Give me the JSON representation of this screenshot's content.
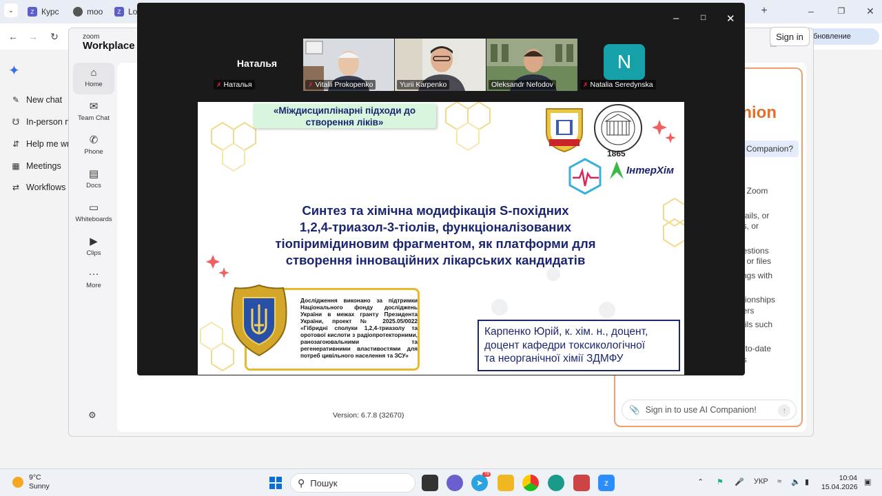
{
  "browser": {
    "tabs": [
      {
        "icon": "zoom-favicon",
        "label": "Курс"
      },
      {
        "icon": "moodle-favicon",
        "label": "moo"
      },
      {
        "icon": "zoom-favicon",
        "label": "Lo"
      }
    ],
    "update_label": "ть обновление"
  },
  "copilot_sidebar": {
    "items": [
      {
        "icon": "new-chat-icon",
        "label": "New chat"
      },
      {
        "icon": "in-person-icon",
        "label": "In-person no"
      },
      {
        "icon": "help-write-icon",
        "label": "Help me wri"
      },
      {
        "icon": "meetings-icon",
        "label": "Meetings"
      },
      {
        "icon": "workflows-icon",
        "label": "Workflows"
      }
    ]
  },
  "zoom_app": {
    "brand_small": "zoom",
    "brand_big": "Workplace",
    "rail": [
      {
        "icon": "home-icon",
        "label": "Home",
        "active": true
      },
      {
        "icon": "team-chat-icon",
        "label": "Team Chat"
      },
      {
        "icon": "phone-icon",
        "label": "Phone"
      },
      {
        "icon": "docs-icon",
        "label": "Docs"
      },
      {
        "icon": "whiteboards-icon",
        "label": "Whiteboards"
      },
      {
        "icon": "clips-icon",
        "label": "Clips"
      },
      {
        "icon": "more-icon",
        "label": "More"
      }
    ],
    "version": "Version: 6.7.8 (32670)",
    "sign_in": "Sign in"
  },
  "ai_companion": {
    "title": "anion",
    "chip": "Companion?",
    "lines": [
      "al Zoom",
      "mails, or",
      "es, or",
      "uestions",
      "s, or files",
      "tings with",
      "ationships",
      "gers",
      "tails such",
      "p-to-date",
      "es"
    ],
    "footer_partial": "......",
    "input_placeholder": "Sign in to use AI Companion!"
  },
  "meeting": {
    "participants": [
      {
        "name": "Наталья",
        "display": "Наталья",
        "muted": true,
        "video": false
      },
      {
        "name": "Vitalii Prokopenko",
        "muted": true,
        "video": true
      },
      {
        "name": "Yurii Karpenko",
        "muted": false,
        "video": true
      },
      {
        "name": "Oleksandr Nefodov",
        "muted": false,
        "video": true,
        "speaking": true
      },
      {
        "name": "Natalia Seredynska",
        "initial": "N",
        "muted": true,
        "video": false
      }
    ],
    "slide": {
      "banner": "«Міждисциплінарні підходи до створення ліків»",
      "title_lines": [
        "Синтез та хімічна модифікація S-похідних",
        "1,2,4-триазол-3-тіолів, функціоналізованих",
        "тіопіримідиновим фрагментом, як платформи для",
        "створення інноваційних лікарських кандидатів"
      ],
      "year": "1865",
      "partner": "ІнтерХім",
      "grant_text": "Дослідження виконано за підтримки Національного фонду досліджень України в межах гранту Президента України, проект № 2025.05/0022 «Гібридні сполуки 1,2,4-триазолу та оротової кислоти з радіопротекторними, ранозагоювальними та регенеративними властивостями для потреб цивільного населення та ЗСУ»",
      "author_lines": [
        "Карпенко Юрій, к. хім. н., доцент,",
        "доцент кафедри токсикологічної",
        "та неорганічної хімії ЗДМФУ"
      ]
    }
  },
  "taskbar": {
    "weather_temp": "9°C",
    "weather_desc": "Sunny",
    "search_placeholder": "Пошук",
    "telegram_badge": "78",
    "language": "УКР",
    "time": "10:04",
    "date": "15.04.2026"
  }
}
